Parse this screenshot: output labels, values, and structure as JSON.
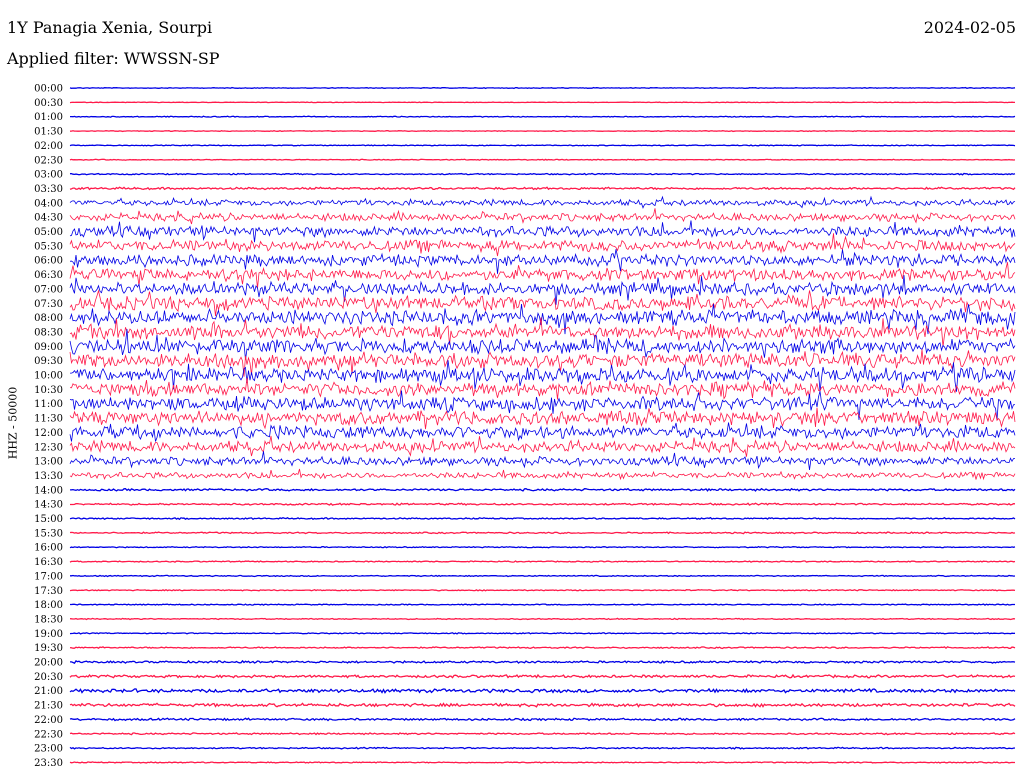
{
  "header": {
    "station": "1Y Panagia Xenia, Sourpi",
    "date": "2024-02-05",
    "filter": "Applied filter: WWSSN-SP"
  },
  "colors": {
    "blue": "#0000e6",
    "red": "#ff1a4a"
  },
  "chart_data": {
    "type": "line",
    "ylabel": "HHZ - 50000",
    "row_labels": [
      "00:00",
      "00:30",
      "01:00",
      "01:30",
      "02:00",
      "02:30",
      "03:00",
      "03:30",
      "04:00",
      "04:30",
      "05:00",
      "05:30",
      "06:00",
      "06:30",
      "07:00",
      "07:30",
      "08:00",
      "08:30",
      "09:00",
      "09:30",
      "10:00",
      "10:30",
      "11:00",
      "11:30",
      "12:00",
      "12:30",
      "13:00",
      "13:30",
      "14:00",
      "14:30",
      "15:00",
      "15:30",
      "16:00",
      "16:30",
      "17:00",
      "17:30",
      "18:00",
      "18:30",
      "19:00",
      "19:30",
      "20:00",
      "20:30",
      "21:00",
      "21:30",
      "22:00",
      "22:30",
      "23:00",
      "23:30"
    ],
    "row_colors": [
      "blue",
      "red",
      "blue",
      "red",
      "blue",
      "red",
      "blue",
      "red",
      "blue",
      "red",
      "blue",
      "red",
      "blue",
      "red",
      "blue",
      "red",
      "blue",
      "red",
      "blue",
      "red",
      "blue",
      "red",
      "blue",
      "red",
      "blue",
      "red",
      "blue",
      "red",
      "blue",
      "red",
      "blue",
      "red",
      "blue",
      "red",
      "blue",
      "red",
      "blue",
      "red",
      "blue",
      "red",
      "blue",
      "red",
      "blue",
      "red",
      "blue",
      "red",
      "blue",
      "red"
    ],
    "noise_level": [
      0.4,
      0.3,
      0.5,
      0.4,
      0.5,
      0.5,
      0.7,
      1.2,
      3.5,
      4.5,
      6.0,
      6.5,
      6.5,
      7.0,
      7.5,
      8.0,
      8.5,
      8.5,
      8.5,
      8.5,
      8.5,
      8.0,
      8.0,
      8.0,
      7.5,
      6.5,
      5.0,
      3.5,
      1.2,
      1.0,
      0.8,
      0.8,
      0.6,
      0.6,
      0.6,
      0.6,
      0.6,
      0.6,
      0.6,
      0.8,
      1.2,
      1.5,
      2.0,
      1.8,
      1.2,
      0.9,
      0.8,
      0.6
    ],
    "grid": false
  }
}
